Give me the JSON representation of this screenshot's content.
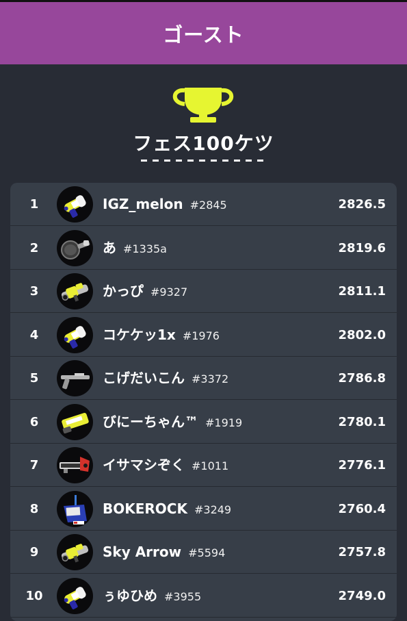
{
  "header": {
    "title": "ゴースト"
  },
  "festival": {
    "title": "フェス100ケツ",
    "trophy_icon": "trophy-icon",
    "trophy_color": "#e6f531"
  },
  "colors": {
    "header_bg": "#97479b",
    "page_bg": "#282c35",
    "board_bg": "#373e48"
  },
  "ranking": [
    {
      "rank": "1",
      "name": "IGZ_melon",
      "tag": "#2845",
      "power": "2826.5",
      "weapon_icon": "blaster-weapon-icon"
    },
    {
      "rank": "2",
      "name": "あ",
      "tag": "#1335a",
      "power": "2819.6",
      "weapon_icon": "brush-weapon-icon"
    },
    {
      "rank": "3",
      "name": "かっぴ",
      "tag": "#9327",
      "power": "2811.1",
      "weapon_icon": "shooter-weapon-icon"
    },
    {
      "rank": "4",
      "name": "コケケッ1x",
      "tag": "#1976",
      "power": "2802.0",
      "weapon_icon": "blaster-weapon-icon"
    },
    {
      "rank": "5",
      "name": "こげだいこん",
      "tag": "#3372",
      "power": "2786.8",
      "weapon_icon": "charger-weapon-icon"
    },
    {
      "rank": "6",
      "name": "びにーちゃん™",
      "tag": "#1919",
      "power": "2780.1",
      "weapon_icon": "roller-weapon-icon"
    },
    {
      "rank": "7",
      "name": "イサマシぞく",
      "tag": "#1011",
      "power": "2776.1",
      "weapon_icon": "splatling-weapon-icon"
    },
    {
      "rank": "8",
      "name": "BOKEROCK",
      "tag": "#3249",
      "power": "2760.4",
      "weapon_icon": "bucket-weapon-icon"
    },
    {
      "rank": "9",
      "name": "Sky Arrow",
      "tag": "#5594",
      "power": "2757.8",
      "weapon_icon": "shooter-weapon-icon"
    },
    {
      "rank": "10",
      "name": "ぅゆひめ",
      "tag": "#3955",
      "power": "2749.0",
      "weapon_icon": "blaster-weapon-icon"
    }
  ]
}
